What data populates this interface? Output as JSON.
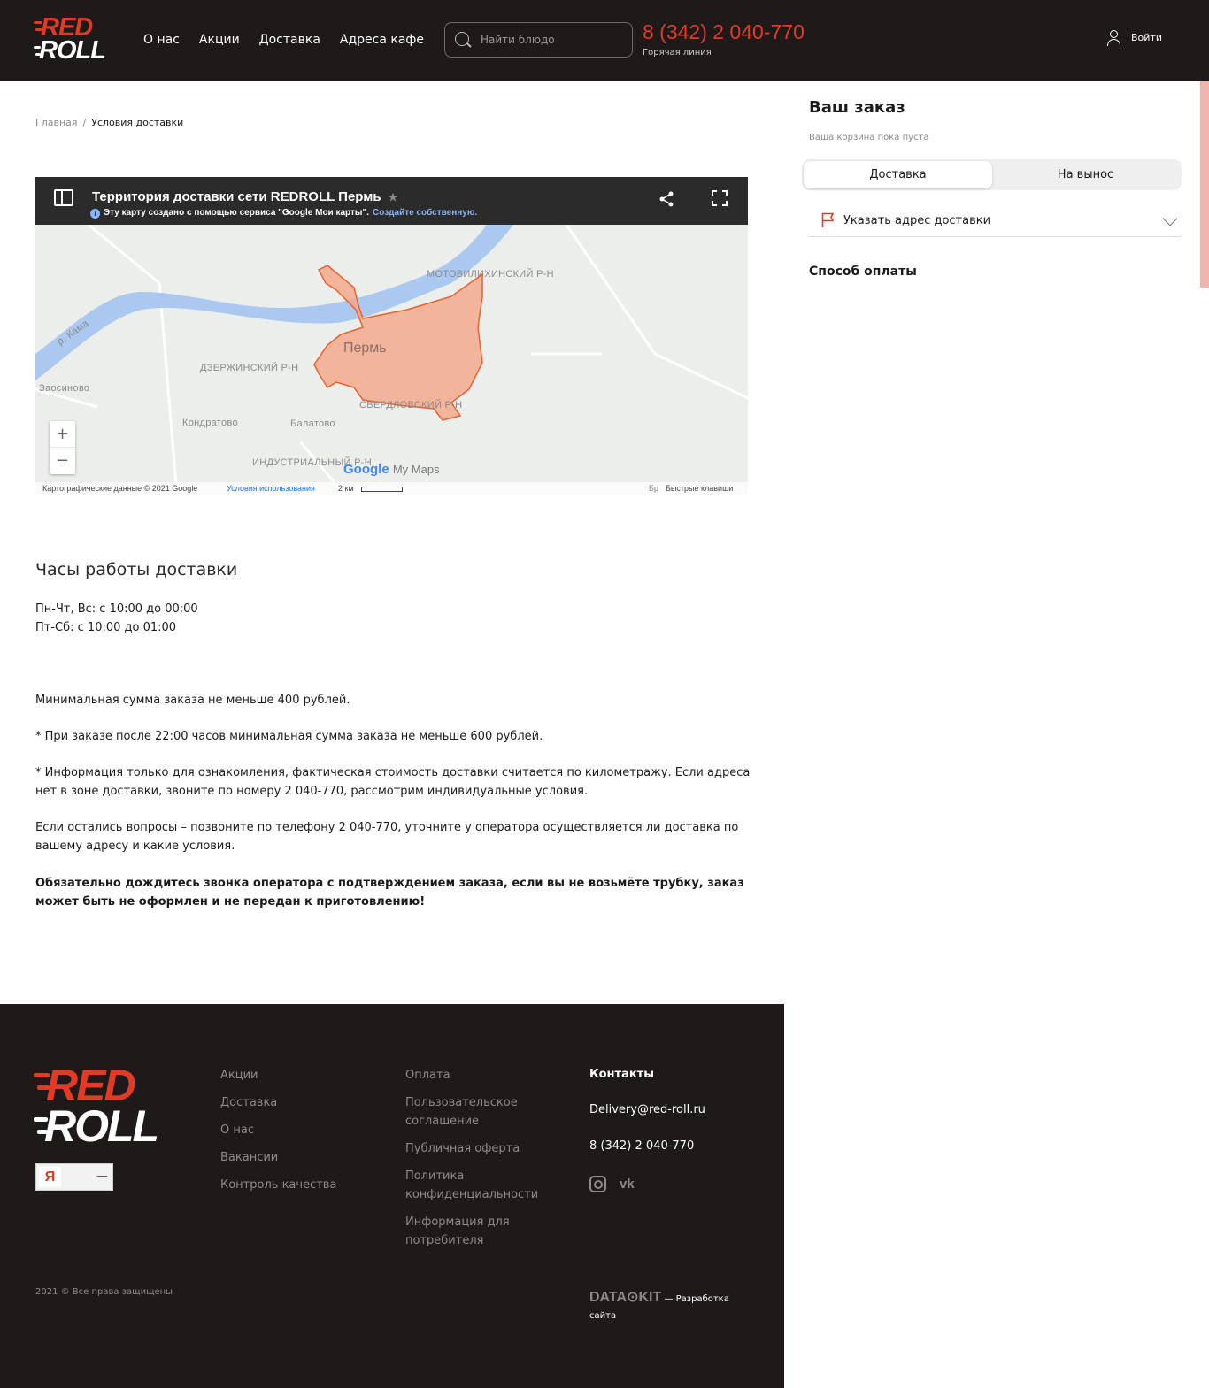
{
  "header": {
    "logo": {
      "top": "RED",
      "bottom": "ROLL"
    },
    "nav": [
      "О нас",
      "Акции",
      "Доставка",
      "Адреса кафе"
    ],
    "search_placeholder": "Найти блюдо",
    "phone": "8 (342) 2 040-770",
    "hotline": "Горячая линия",
    "login": "Войти"
  },
  "breadcrumb": {
    "home": "Главная",
    "sep": "/",
    "current": "Условия доставки"
  },
  "map": {
    "title": "Территория доставки сети REDROLL Пермь",
    "star": "★",
    "info_icon": "i",
    "subtitle": "Эту карту создано с помощью сервиса \"Google Мои карты\".",
    "subtitle_link": "Создайте собственную.",
    "city": "Пермь",
    "labels": {
      "motovilikha": "МОТОВИЛИХИНСКИЙ Р-Н",
      "kama": "р. Кама",
      "dzerzhinsky": "ДЗЕРЖИНСКИЙ Р-Н",
      "zaosinovo": "Заосиново",
      "kondratovo": "Кондратово",
      "balatovo": "Балатово",
      "sverdlovsky": "СВЕРДЛОВСКИЙ Р-Н",
      "industrial": "ИНДУСТРИАЛЬНЫЙ Р-Н"
    },
    "zoom_in": "+",
    "zoom_out": "−",
    "brand_google": "Google",
    "brand_mymaps": "My Maps",
    "footer_copy": "Картографические данные © 2021 Google",
    "footer_terms": "Условия использования",
    "footer_scale": "2 км",
    "footer_br": "Бр",
    "footer_keys": "Быстрые клавиши",
    "colors": {
      "zone_fill": "#f3a98c",
      "zone_stroke": "#e8622f",
      "river": "#aac8f0"
    }
  },
  "content": {
    "hours_title": "Часы работы доставки",
    "hours_1": "Пн-Чт, Вс: с 10:00 до 00:00",
    "hours_2": "Пт-Сб: с 10:00 до 01:00",
    "min_sum": "Минимальная сумма заказа не меньше 400 рублей.",
    "note_22": "* При заказе после 22:00 часов минимальная сумма заказа не меньше 600 рублей.",
    "note_info": "* Информация только для ознакомления, фактическая стоимость доставки считается по километражу. Если адреса нет в зоне доставки, звоните по номеру 2 040-770, рассмотрим индивидуальные условия.",
    "questions": "Если остались вопросы – позвоните по телефону 2 040-770, уточните у оператора осуществляется ли доставка по вашему адресу и какие условия.",
    "warning": "Обязательно дождитесь звонка оператора с подтверждением заказа, если вы не возьмёте трубку, заказ может быть не оформлен и не передан к приготовлению!"
  },
  "sidebar": {
    "title": "Ваш заказ",
    "empty": "Ваша корзина пока пуста",
    "tab_delivery": "Доставка",
    "tab_pickup": "На вынос",
    "address": "Указать адрес доставки",
    "payment": "Способ оплаты"
  },
  "footer": {
    "logo": {
      "top": "RED",
      "bottom": "ROLL"
    },
    "yandex": "Я",
    "yandex_value": "—",
    "col1": [
      "Акции",
      "Доставка",
      "О нас",
      "Вакансии",
      "Контроль качества"
    ],
    "col2": [
      "Оплата",
      "Пользовательское соглашение",
      "Публичная оферта",
      "Политика конфиденциальности",
      "Информация для потребителя"
    ],
    "contacts_title": "Контакты",
    "email": "Delivery@red-roll.ru",
    "phone": "8 (342) 2 040-770",
    "vk": "vk",
    "copyright": "2021 © Все права защищены",
    "datakit_logo": "DATA⊙KIT",
    "datakit_text": "— Разработка сайта"
  },
  "brand_colors": {
    "accent": "#e23b25",
    "dark": "#1e1a1a"
  }
}
